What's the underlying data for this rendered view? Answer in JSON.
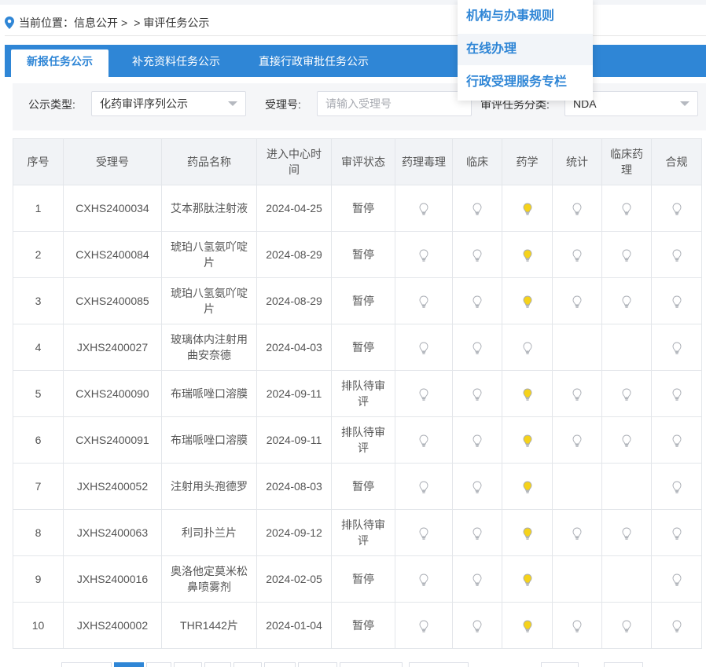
{
  "breadcrumb": {
    "label": "当前位置：",
    "part1": "信息公开",
    "sep1": ">",
    "sep2": ">",
    "current": "审评任务公示"
  },
  "tabs": [
    {
      "label": "新报任务公示",
      "active": true
    },
    {
      "label": "补充资料任务公示",
      "active": false
    },
    {
      "label": "直接行政审批任务公示",
      "active": false
    }
  ],
  "popup_menu": [
    {
      "label": "机构与办事规则"
    },
    {
      "label": "在线办理"
    },
    {
      "label": "行政受理服务专栏"
    }
  ],
  "filters": {
    "type_label": "公示类型:",
    "type_value": "化药审评序列公示",
    "accept_label": "受理号:",
    "accept_placeholder": "请输入受理号",
    "category_label": "审评任务分类:",
    "category_value": "NDA"
  },
  "table": {
    "headers": [
      "序号",
      "受理号",
      "药品名称",
      "进入中心时间",
      "审评状态",
      "药理毒理",
      "临床",
      "药学",
      "统计",
      "临床药理",
      "合规"
    ],
    "rows": [
      {
        "no": "1",
        "id": "CXHS2400034",
        "name": "艾本那肽注射液",
        "date": "2024-04-25",
        "status": "暂停",
        "bulbs": [
          "off",
          "off",
          "on",
          "off",
          "off",
          "off"
        ]
      },
      {
        "no": "2",
        "id": "CXHS2400084",
        "name": "琥珀八氢氨吖啶片",
        "date": "2024-08-29",
        "status": "暂停",
        "bulbs": [
          "off",
          "off",
          "on",
          "off",
          "off",
          "off"
        ]
      },
      {
        "no": "3",
        "id": "CXHS2400085",
        "name": "琥珀八氢氨吖啶片",
        "date": "2024-08-29",
        "status": "暂停",
        "bulbs": [
          "off",
          "off",
          "on",
          "off",
          "off",
          "off"
        ]
      },
      {
        "no": "4",
        "id": "JXHS2400027",
        "name": "玻璃体内注射用曲安奈德",
        "date": "2024-04-03",
        "status": "暂停",
        "bulbs": [
          "off",
          "off",
          "off",
          "none",
          "none",
          "off"
        ]
      },
      {
        "no": "5",
        "id": "CXHS2400090",
        "name": "布瑞哌唑口溶膜",
        "date": "2024-09-11",
        "status": "排队待审评",
        "bulbs": [
          "off",
          "off",
          "on",
          "off",
          "off",
          "off"
        ]
      },
      {
        "no": "6",
        "id": "CXHS2400091",
        "name": "布瑞哌唑口溶膜",
        "date": "2024-09-11",
        "status": "排队待审评",
        "bulbs": [
          "off",
          "off",
          "on",
          "off",
          "off",
          "off"
        ]
      },
      {
        "no": "7",
        "id": "JXHS2400052",
        "name": "注射用头孢德罗",
        "date": "2024-08-03",
        "status": "暂停",
        "bulbs": [
          "off",
          "off",
          "on",
          "none",
          "none",
          "off"
        ]
      },
      {
        "no": "8",
        "id": "JXHS2400063",
        "name": "利司扑兰片",
        "date": "2024-09-12",
        "status": "排队待审评",
        "bulbs": [
          "off",
          "off",
          "on",
          "off",
          "off",
          "off"
        ]
      },
      {
        "no": "9",
        "id": "JXHS2400016",
        "name": "奥洛他定莫米松鼻喷雾剂",
        "date": "2024-02-05",
        "status": "暂停",
        "bulbs": [
          "off",
          "off",
          "on",
          "none",
          "none",
          "off"
        ]
      },
      {
        "no": "10",
        "id": "JXHS2400002",
        "name": "THR1442片",
        "date": "2024-01-04",
        "status": "暂停",
        "bulbs": [
          "off",
          "off",
          "on",
          "off",
          "off",
          "off"
        ]
      }
    ]
  },
  "colors": {
    "accent": "#2f86d6",
    "bulb_on": "#f5d21b",
    "bulb_off": "#ffffff",
    "header_bg": "#f1f3f6"
  }
}
